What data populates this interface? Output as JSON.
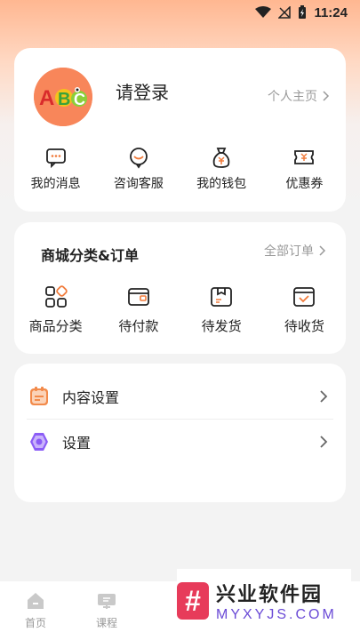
{
  "status_bar": {
    "time": "11:24",
    "icons": [
      "wifi-icon",
      "signal-off-icon",
      "battery-charging-icon"
    ]
  },
  "profile": {
    "avatar_text": "ABC",
    "login_text": "请登录",
    "homepage_link": "个人主页",
    "actions": [
      {
        "label": "我的消息",
        "icon": "message-icon"
      },
      {
        "label": "咨询客服",
        "icon": "customer-service-icon"
      },
      {
        "label": "我的钱包",
        "icon": "wallet-bag-icon"
      },
      {
        "label": "优惠券",
        "icon": "coupon-icon"
      }
    ]
  },
  "orders": {
    "title": "商城分类&订单",
    "all_orders_link": "全部订单",
    "items": [
      {
        "label": "商品分类",
        "icon": "category-icon"
      },
      {
        "label": "待付款",
        "icon": "pending-payment-icon"
      },
      {
        "label": "待发货",
        "icon": "pending-shipment-icon"
      },
      {
        "label": "待收货",
        "icon": "pending-receipt-icon"
      }
    ]
  },
  "settings": {
    "items": [
      {
        "label": "内容设置",
        "icon": "content-settings-icon",
        "color": "#f28a4a"
      },
      {
        "label": "设置",
        "icon": "settings-hex-icon",
        "color": "#8b5cf6"
      }
    ]
  },
  "tabbar": {
    "tabs": [
      {
        "label": "首页",
        "icon": "home-icon"
      },
      {
        "label": "课程",
        "icon": "course-icon"
      }
    ]
  },
  "watermark": {
    "logo_char": "#",
    "title": "兴业软件园",
    "subtitle": "MYXYJS.COM"
  }
}
